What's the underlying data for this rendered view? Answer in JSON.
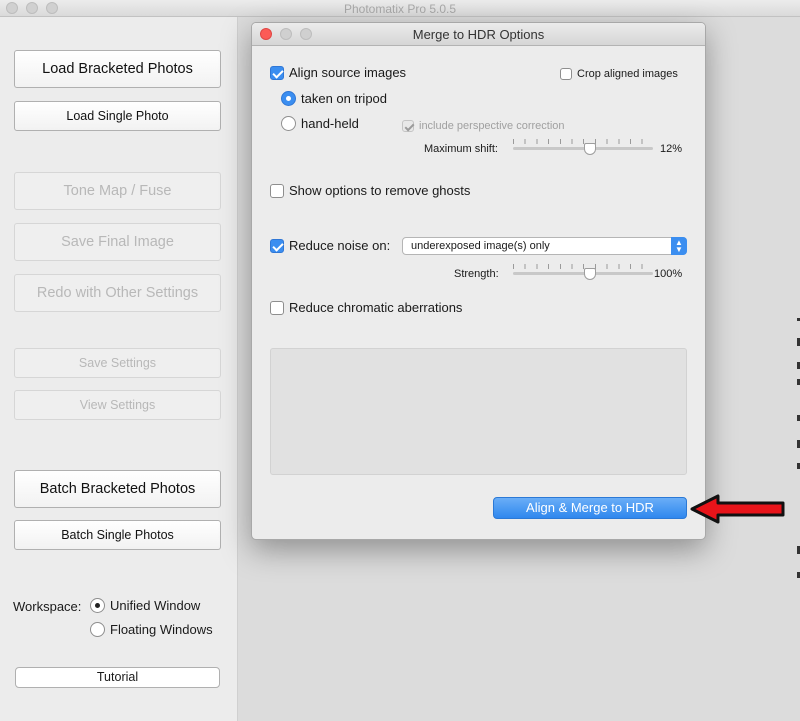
{
  "app": {
    "title": "Photomatix Pro 5.0.5"
  },
  "sidebar": {
    "load_bracketed": "Load Bracketed Photos",
    "load_single": "Load Single Photo",
    "tone_map": "Tone Map / Fuse",
    "save_final": "Save Final Image",
    "redo": "Redo with Other Settings",
    "save_settings": "Save Settings",
    "view_settings": "View Settings",
    "batch_bracketed": "Batch Bracketed Photos",
    "batch_single": "Batch Single Photos",
    "workspace_label": "Workspace:",
    "workspace_options": [
      "Unified Window",
      "Floating Windows"
    ],
    "workspace_selected": "Unified Window",
    "tutorial": "Tutorial"
  },
  "dialog": {
    "title": "Merge to HDR Options",
    "align_source": "Align source images",
    "align_source_checked": true,
    "crop_aligned": "Crop aligned images",
    "crop_aligned_checked": false,
    "tripod": "taken on tripod",
    "handheld": "hand-held",
    "alignment_mode": "taken on tripod",
    "perspective": "include perspective correction",
    "perspective_checked": true,
    "max_shift_label": "Maximum shift:",
    "max_shift_value": "12%",
    "max_shift_level": 0.55,
    "ghosts": "Show options to remove ghosts",
    "ghosts_checked": false,
    "reduce_noise": "Reduce noise on:",
    "reduce_noise_checked": true,
    "noise_target": "underexposed image(s) only",
    "strength_label": "Strength:",
    "strength_value": "100%",
    "strength_level": 0.55,
    "chromatic": "Reduce chromatic aberrations",
    "chromatic_checked": false,
    "merge_button": "Align & Merge to HDR"
  },
  "colors": {
    "accent": "#3b8ef0",
    "close": "#fc5b57",
    "arrow": "#e8141a"
  }
}
